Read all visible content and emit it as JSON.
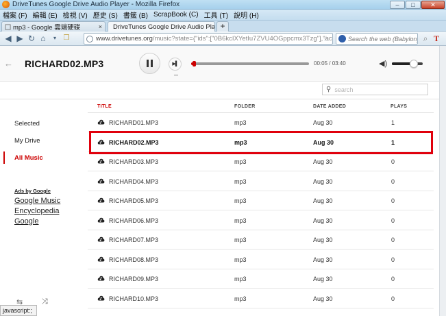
{
  "window": {
    "title": "DriveTunes Google Drive Audio Player - Mozilla Firefox",
    "menu": [
      "檔案 (F)",
      "編輯 (E)",
      "檢視 (V)",
      "歷史 (S)",
      "書籤 (B)",
      "ScrapBook (C)",
      "工具 (T)",
      "說明 (H)"
    ],
    "tabs": [
      {
        "label": "mp3 - Google 雲端硬碟",
        "close": "×"
      },
      {
        "label": "DriveTunes Google Drive Audio Pla...",
        "close": "×"
      }
    ],
    "new_tab": "+",
    "url_host": "www.drivetunes.org",
    "url_path": "/music?state={\"ids\":[\"0B6kcIXYetIu7ZVU4OGppcmx3Tzg\"],\"action\":\"op",
    "search_placeholder": "Search the web (Babylon)",
    "win_buttons": {
      "min": "–",
      "max": "□",
      "close": "✕"
    }
  },
  "player": {
    "now_playing": "RICHARD02.MP3",
    "time": "00:05 / 03:40",
    "progress_fraction": 0.023,
    "volume_fraction": 0.7
  },
  "search": {
    "placeholder": "search"
  },
  "sidebar": {
    "items": [
      {
        "label": "Selected"
      },
      {
        "label": "My Drive"
      },
      {
        "label": "All Music",
        "active": true
      }
    ],
    "ads_title": "Ads by Google",
    "ads": [
      "Google Music",
      "Encyclopedia",
      "Google"
    ]
  },
  "table": {
    "headers": {
      "title": "TITLE",
      "folder": "FOLDER",
      "date": "DATE ADDED",
      "plays": "PLAYS"
    },
    "rows": [
      {
        "title": "RICHARD01.MP3",
        "folder": "mp3",
        "date": "Aug 30",
        "plays": "1"
      },
      {
        "title": "RICHARD02.MP3",
        "folder": "mp3",
        "date": "Aug 30",
        "plays": "1"
      },
      {
        "title": "RICHARD03.MP3",
        "folder": "mp3",
        "date": "Aug 30",
        "plays": "0"
      },
      {
        "title": "RICHARD04.MP3",
        "folder": "mp3",
        "date": "Aug 30",
        "plays": "0"
      },
      {
        "title": "RICHARD05.MP3",
        "folder": "mp3",
        "date": "Aug 30",
        "plays": "0"
      },
      {
        "title": "RICHARD06.MP3",
        "folder": "mp3",
        "date": "Aug 30",
        "plays": "0"
      },
      {
        "title": "RICHARD07.MP3",
        "folder": "mp3",
        "date": "Aug 30",
        "plays": "0"
      },
      {
        "title": "RICHARD08.MP3",
        "folder": "mp3",
        "date": "Aug 30",
        "plays": "0"
      },
      {
        "title": "RICHARD09.MP3",
        "folder": "mp3",
        "date": "Aug 30",
        "plays": "0"
      },
      {
        "title": "RICHARD10.MP3",
        "folder": "mp3",
        "date": "Aug 30",
        "plays": "0"
      }
    ]
  },
  "statusbar": {
    "text": "javascript:;"
  },
  "colors": {
    "accent": "#cc0000",
    "highlight_box": "#e0000c"
  }
}
